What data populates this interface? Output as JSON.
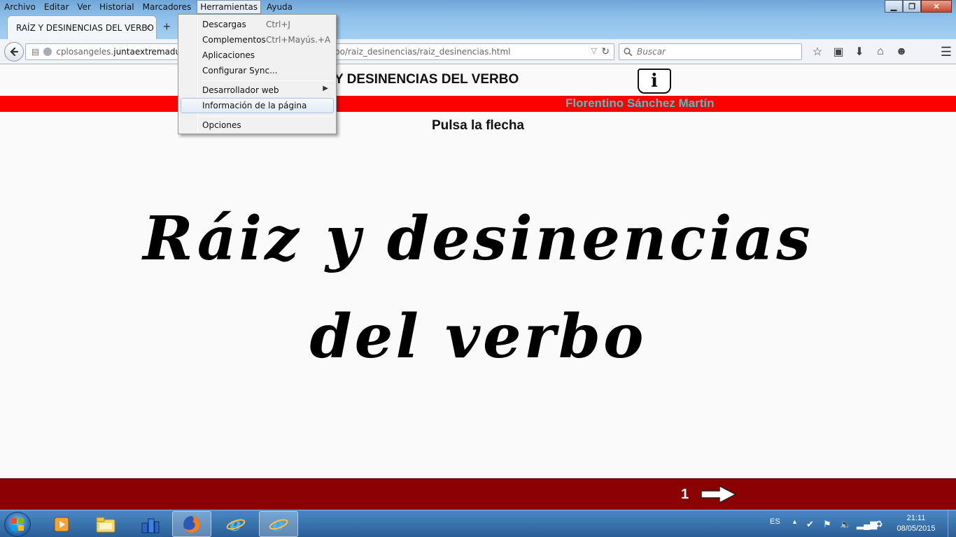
{
  "menubar": {
    "items": [
      "Archivo",
      "Editar",
      "Ver",
      "Historial",
      "Marcadores",
      "Herramientas",
      "Ayuda"
    ],
    "active_index": 5
  },
  "tab": {
    "title": "RAÍZ Y DESINENCIAS DEL VERBO",
    "close": "×",
    "new_tab": "+"
  },
  "window_controls": {
    "minimize": "▁",
    "maximize": "❐",
    "close": "✕"
  },
  "urlbar": {
    "domain_prefix": "cplosangeles.",
    "domain_main": "juntaextremadura",
    "path_visible": "bo/raiz_desinencias/raiz_desinencias.html",
    "dropdown": "▽",
    "reload": "↻"
  },
  "search": {
    "placeholder": "Buscar",
    "icon": "search-icon"
  },
  "toolbar_icons": [
    "star-icon",
    "reading-list-icon",
    "download-icon",
    "home-icon",
    "chat-icon"
  ],
  "dropdown_menu": {
    "items": [
      {
        "label": "Descargas",
        "shortcut": "Ctrl+J"
      },
      {
        "label": "Complementos",
        "shortcut": "Ctrl+Mayús.+A"
      },
      {
        "label": "Aplicaciones",
        "shortcut": ""
      },
      {
        "label": "Configurar Sync...",
        "shortcut": ""
      },
      {
        "label": "Desarrollador web",
        "shortcut": "",
        "submenu": "▶"
      },
      {
        "label": "Información de la página",
        "shortcut": "",
        "highlighted": true
      },
      {
        "label": "Opciones",
        "shortcut": ""
      }
    ]
  },
  "page": {
    "header_title": "Y DESINENCIAS DEL VERBO",
    "info_icon": "i",
    "author": "Florentino Sánchez Martín",
    "instruction": "Pulsa la flecha",
    "title_line1": "Ráiz y desinencias",
    "title_line2": "del verbo",
    "page_number": "1",
    "colors": {
      "red_band": "#ff0000",
      "author_text": "#40c4c4",
      "footer": "#8b0000"
    }
  },
  "taskbar": {
    "apps": [
      "media-player-icon",
      "file-explorer-icon",
      "network-app-icon",
      "firefox-icon",
      "internet-explorer-icon",
      "internet-explorer-icon"
    ],
    "active_app_index": 3,
    "language": "ES",
    "time": "21:11",
    "date": "08/05/2015"
  }
}
